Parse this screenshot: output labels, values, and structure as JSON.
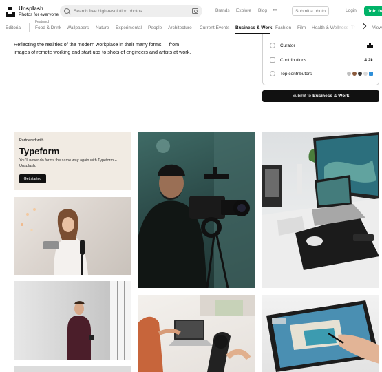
{
  "header": {
    "logo_name": "Unsplash",
    "logo_tagline": "Photos for everyone",
    "search_placeholder": "Search free high-resolution photos",
    "nav": [
      "Brands",
      "Explore",
      "Blog"
    ],
    "submit_label": "Submit a photo",
    "login_label": "Login",
    "join_label": "Join free"
  },
  "categories": {
    "editorial": "Editorial",
    "featured_label": "Featured",
    "items": [
      "Food & Drink",
      "Wallpapers",
      "Nature",
      "Experimental",
      "People",
      "Architecture",
      "Current Events",
      "Business & Work",
      "Fashion",
      "Film",
      "Health & Wellness",
      "Tr"
    ],
    "active": "Business & Work",
    "view_all": "View"
  },
  "description": "Reflecting the realities of the modern workplace in their many forms — from images of remote working and start-ups to shots of engineers and artists at work.",
  "info_card": {
    "curator_label": "Curator",
    "contributions_label": "Contributions",
    "contributions_value": "4.2k",
    "top_contributors_label": "Top contributors",
    "avatar_colors": [
      "#bfbfbf",
      "#8a5a3c",
      "#3b3b3b",
      "#d9d9d9",
      "#2f8fd8"
    ]
  },
  "cta": {
    "prefix": "Submit to",
    "bold": "Business & Work"
  },
  "promo": {
    "partner_label": "Partnered with",
    "brand": "Typeform",
    "body": "You'll never do forms the same way again with Typeform + Unsplash.",
    "button": "Get started"
  },
  "photos": [
    {
      "alt": "woman recording video with camera"
    },
    {
      "alt": "man using smartphone by window"
    },
    {
      "alt": "man filming with cinema camera"
    },
    {
      "alt": "person working on laptop"
    },
    {
      "alt": "laptop and monitor desk setup"
    },
    {
      "alt": "graphic tablet drawing"
    }
  ]
}
